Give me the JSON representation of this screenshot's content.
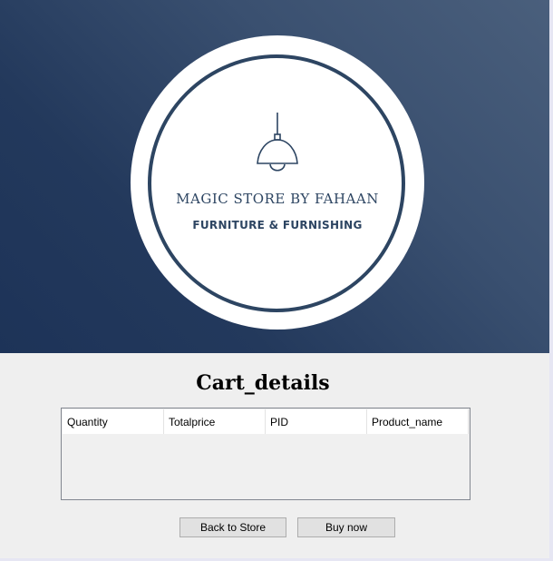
{
  "banner": {
    "brand_name": "MAGIC STORE BY FAHAAN",
    "brand_tagline": "FURNITURE & FURNISHING",
    "colors": {
      "banner_dark": "#1d3358",
      "banner_light": "#4a5f7c",
      "logo_ink": "#2d4562"
    }
  },
  "cart": {
    "title": "Cart_details",
    "columns": [
      "Quantity",
      "Totalprice",
      "PID",
      "Product_name"
    ],
    "rows": []
  },
  "actions": {
    "back_label": "Back to Store",
    "buy_label": "Buy now"
  }
}
